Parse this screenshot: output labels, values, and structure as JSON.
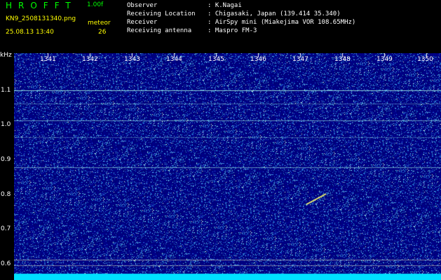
{
  "app": {
    "title": "HROFFT",
    "version": "1.00f"
  },
  "file": {
    "name": "KN9_2508131340.png",
    "mode": "meteor",
    "datetime": "25.08.13 13:40",
    "count": "26"
  },
  "info": [
    {
      "label": "Observer",
      "value": ": K.Nagai"
    },
    {
      "label": "Receiving Location",
      "value": ": Chigasaki, Japan (139.414 35.340)"
    },
    {
      "label": "Receiver",
      "value": ": AirSpy mini (Miakejima VOR 108.65MHz)"
    },
    {
      "label": "Receiving antenna",
      "value": ": Maspro FM-3"
    }
  ],
  "axis": {
    "y_unit": "kHz",
    "y_ticks": [
      "1.1",
      "1.0",
      "0.9",
      "0.8",
      "0.7",
      "0.6"
    ],
    "x_ticks": [
      "1341",
      "1342",
      "1343",
      "1344",
      "1345",
      "1346",
      "1347",
      "1348",
      "1349",
      "1350"
    ]
  },
  "colors": {
    "background": "#000000",
    "plot_bg": "#00007a",
    "title": "#00ff00",
    "labels": "#ffff00",
    "text": "#ffffff",
    "signal_line": "#aaffee",
    "bottom_band": "#00e0ff"
  }
}
